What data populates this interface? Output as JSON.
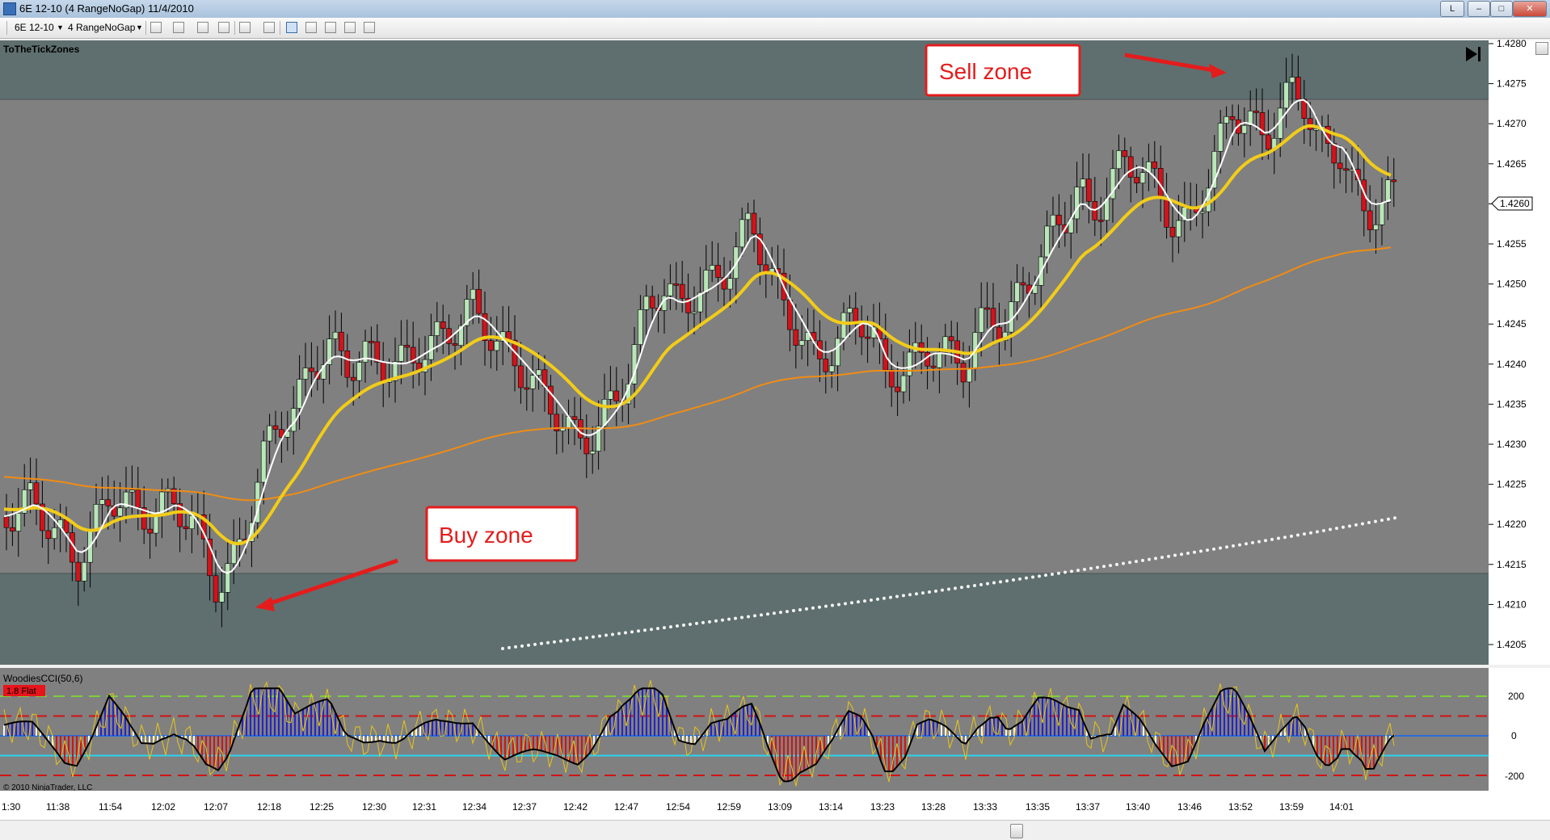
{
  "window": {
    "title": "6E 12-10 (4 RangeNoGap)  11/4/2010",
    "btn_l": "L"
  },
  "toolbar": {
    "instrument": "6E 12-10",
    "interval": "4 RangeNoGap"
  },
  "chart": {
    "indicator_label": "ToTheTickZones",
    "copyright": "© 2010 NinjaTrader, LLC",
    "price_axis_labels": [
      "1.4280",
      "1.4275",
      "1.4270",
      "1.4265",
      "1.4260",
      "1.4255",
      "1.4250",
      "1.4245",
      "1.4240",
      "1.4235",
      "1.4230",
      "1.4225",
      "1.4220",
      "1.4215",
      "1.4210",
      "1.4205"
    ],
    "last_price": "1.4260",
    "time_labels": [
      "1:30",
      "11:38",
      "11:54",
      "12:02",
      "12:07",
      "12:18",
      "12:25",
      "12:30",
      "12:31",
      "12:34",
      "12:37",
      "12:42",
      "12:47",
      "12:54",
      "12:59",
      "13:09",
      "13:14",
      "13:23",
      "13:28",
      "13:33",
      "13:35",
      "13:37",
      "13:40",
      "13:46",
      "13:52",
      "13:59",
      "14:01"
    ],
    "annotations": {
      "sell": "Sell zone",
      "buy": "Buy zone"
    },
    "cci": {
      "label": "WoodiesCCI(50,6)",
      "badge": "1.8 Flat",
      "axis_labels": [
        "200",
        "0",
        "-200"
      ]
    },
    "colors": {
      "panel_bg": "#808080",
      "zone_bg": "#5f6f6f",
      "bull_candle": "#b8e6b8",
      "bear_candle": "#d0141c",
      "ema_fast": "#ffffff",
      "ema_mid": "#f2cc18",
      "ema_slow": "#f08c14",
      "annotation_red": "#e41c1c"
    }
  }
}
